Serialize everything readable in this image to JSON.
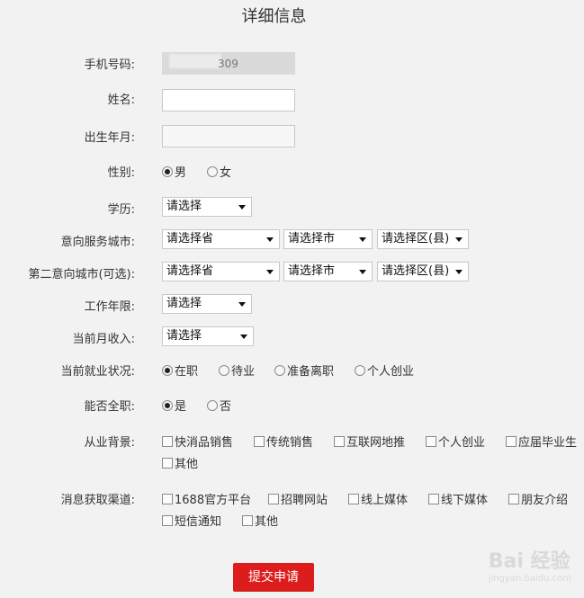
{
  "title": "详细信息",
  "phone": {
    "label": "手机号码:",
    "suffix": "309"
  },
  "name": {
    "label": "姓名:"
  },
  "birth": {
    "label": "出生年月:"
  },
  "gender": {
    "label": "性别:",
    "options": [
      "男",
      "女"
    ],
    "selected": "男"
  },
  "education": {
    "label": "学历:",
    "value": "请选择"
  },
  "city1": {
    "label": "意向服务城市:",
    "province": "请选择省",
    "city": "请选择市",
    "district": "请选择区(县)"
  },
  "city2": {
    "label": "第二意向城市(可选):",
    "province": "请选择省",
    "city": "请选择市",
    "district": "请选择区(县)"
  },
  "years": {
    "label": "工作年限:",
    "value": "请选择"
  },
  "income": {
    "label": "当前月收入:",
    "value": "请选择"
  },
  "employment": {
    "label": "当前就业状况:",
    "options": [
      "在职",
      "待业",
      "准备离职",
      "个人创业"
    ],
    "selected": "在职"
  },
  "fulltime": {
    "label": "能否全职:",
    "options": [
      "是",
      "否"
    ],
    "selected": "是"
  },
  "background": {
    "label": "从业背景:",
    "options": [
      "快消品销售",
      "传统销售",
      "互联网地推",
      "个人创业",
      "应届毕业生",
      "其他"
    ]
  },
  "channel": {
    "label": "消息获取渠道:",
    "options": [
      "1688官方平台",
      "招聘网站",
      "线上媒体",
      "线下媒体",
      "朋友介绍",
      "短信通知",
      "其他"
    ]
  },
  "submit_label": "提交申请",
  "watermark": {
    "main": "Bai 经验",
    "sub": "jingyan.baidu.com"
  }
}
